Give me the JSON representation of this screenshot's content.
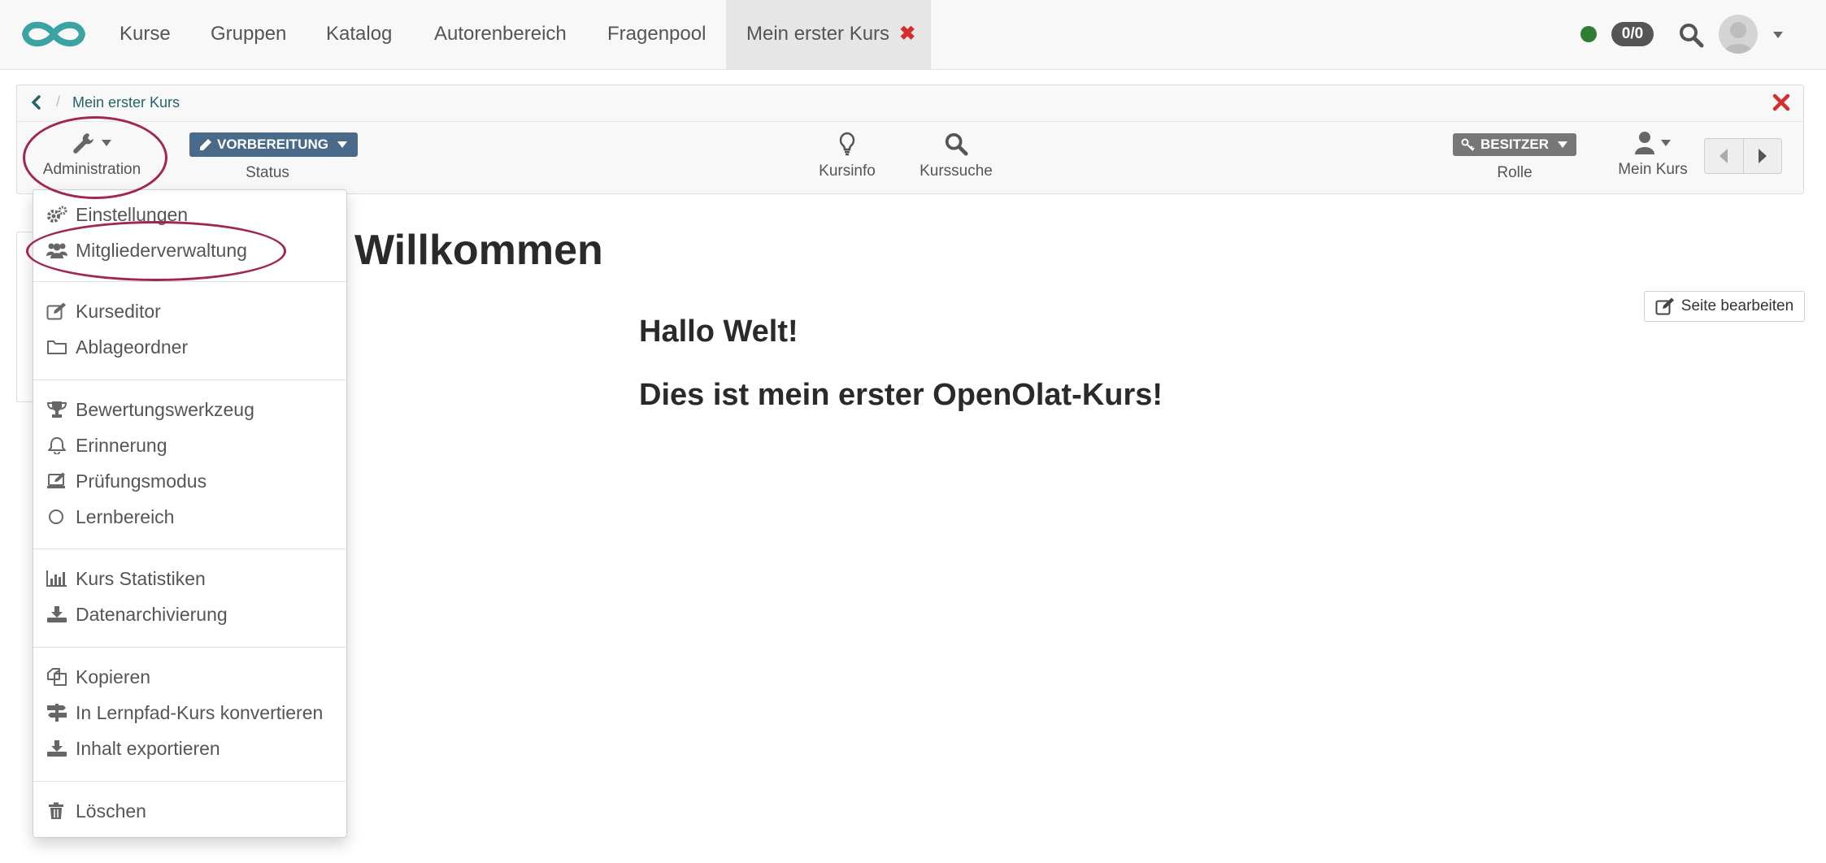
{
  "colors": {
    "accent": "#27616a",
    "logo": "#3ba3a4",
    "close": "#d32f2f",
    "status_badge": "#4a6a8a",
    "online": "#2e7d32",
    "highlight": "#a0284e"
  },
  "topnav": {
    "logo_icon": "infinity-logo-icon",
    "items": [
      {
        "label": "Kurse"
      },
      {
        "label": "Gruppen"
      },
      {
        "label": "Katalog"
      },
      {
        "label": "Autorenbereich"
      },
      {
        "label": "Fragenpool"
      }
    ],
    "active_tab": {
      "label": "Mein erster Kurs",
      "close_symbol": "✖"
    },
    "counter": "0/0",
    "icons": [
      "status-dot-icon",
      "search-icon",
      "avatar",
      "caret-down-icon"
    ]
  },
  "breadcrumb": {
    "current": "Mein erster Kurs",
    "separator": "/"
  },
  "toolbar": {
    "administration_label": "Administration",
    "status_value": "VORBEREITUNG",
    "status_label": "Status",
    "kursinfo_label": "Kursinfo",
    "kurssuche_label": "Kurssuche",
    "role_value": "BESITZER",
    "role_label": "Rolle",
    "mein_kurs_label": "Mein Kurs"
  },
  "admin_menu": {
    "groups": [
      [
        {
          "label": "Einstellungen",
          "icon": "cogs-icon"
        },
        {
          "label": "Mitgliederverwaltung",
          "icon": "users-icon"
        }
      ],
      [
        {
          "label": "Kurseditor",
          "icon": "edit-icon"
        },
        {
          "label": "Ablageordner",
          "icon": "folder-icon"
        }
      ],
      [
        {
          "label": "Bewertungswerkzeug",
          "icon": "trophy-icon"
        },
        {
          "label": "Erinnerung",
          "icon": "bell-icon"
        },
        {
          "label": "Prüfungsmodus",
          "icon": "exam-icon"
        },
        {
          "label": "Lernbereich",
          "icon": "circle-icon"
        }
      ],
      [
        {
          "label": "Kurs Statistiken",
          "icon": "bar-chart-icon"
        },
        {
          "label": "Datenarchivierung",
          "icon": "download-icon"
        }
      ],
      [
        {
          "label": "Kopieren",
          "icon": "copy-icon"
        },
        {
          "label": "In Lernpfad-Kurs konvertieren",
          "icon": "signpost-icon"
        },
        {
          "label": "Inhalt exportieren",
          "icon": "export-icon"
        }
      ],
      [
        {
          "label": "Löschen",
          "icon": "trash-icon"
        }
      ]
    ]
  },
  "content": {
    "title": "Willkommen",
    "edit_button": "Seite bearbeiten",
    "heading1": "Hallo Welt!",
    "heading2": "Dies ist mein erster OpenOlat-Kurs!"
  }
}
